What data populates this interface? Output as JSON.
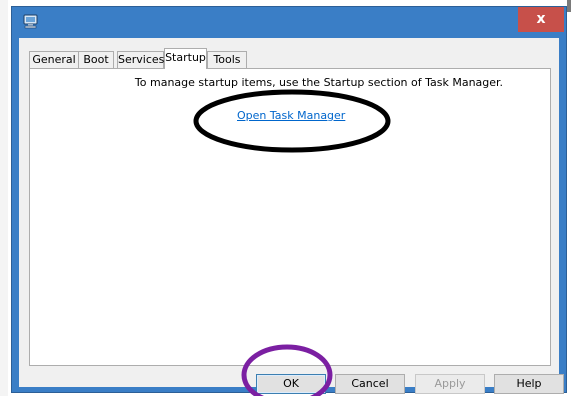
{
  "window": {
    "tabs": [
      {
        "label": "General"
      },
      {
        "label": "Boot"
      },
      {
        "label": "Services"
      },
      {
        "label": "Startup"
      },
      {
        "label": "Tools"
      }
    ],
    "active_tab": "Startup",
    "close_label": "x"
  },
  "startup": {
    "message": "To manage startup items, use the Startup section of Task Manager.",
    "link": "Open Task Manager"
  },
  "buttons": {
    "ok": "OK",
    "cancel": "Cancel",
    "apply": "Apply",
    "help": "Help"
  },
  "annotations": {
    "color_link_circle": "#000000",
    "color_ok_circle": "#7b1fa2"
  },
  "icons": {
    "app": "msconfig-computer-icon",
    "close": "close-icon"
  }
}
